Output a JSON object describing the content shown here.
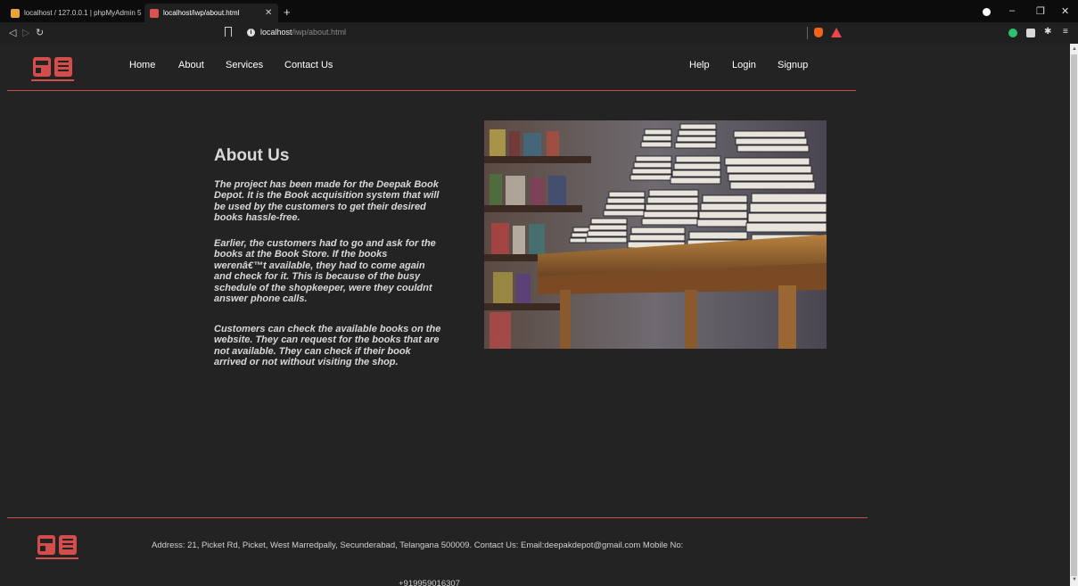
{
  "browser": {
    "tabs": [
      {
        "title": "localhost / 127.0.0.1 | phpMyAdmin 5"
      },
      {
        "title": "localhost/iwp/about.html"
      }
    ],
    "url_host": "localhost",
    "url_path": "/iwp/about.html"
  },
  "nav": {
    "left": [
      "Home",
      "About",
      "Services",
      "Contact Us"
    ],
    "right": [
      "Help",
      "Login",
      "Signup"
    ]
  },
  "about": {
    "title": "About Us",
    "paragraphs": [
      "The project has been made for the Deepak Book Depot. It is the Book acquisition system that will be used by the customers to get their desired books hassle-free.",
      "Earlier, the customers had to go and ask for the books at the Book Store. If the books werenâ€™t available, they had to come again and check for it. This is because of the busy schedule of the shopkeeper, were they couldnt answer phone calls.",
      "Customers can check the available books on the website. They can request for the books that are not available. They can check if their book arrived or not without visiting the shop."
    ]
  },
  "footer": {
    "address": "Address: 21, Picket Rd, Picket, West Marredpally, Secunderabad, Telangana 500009. Contact Us: Email:deepakdepot@gmail.com Mobile No:",
    "phone": "+919959016307"
  },
  "colors": {
    "accent": "#d44d4d",
    "background": "#232323",
    "text": "#d8d8d8"
  }
}
